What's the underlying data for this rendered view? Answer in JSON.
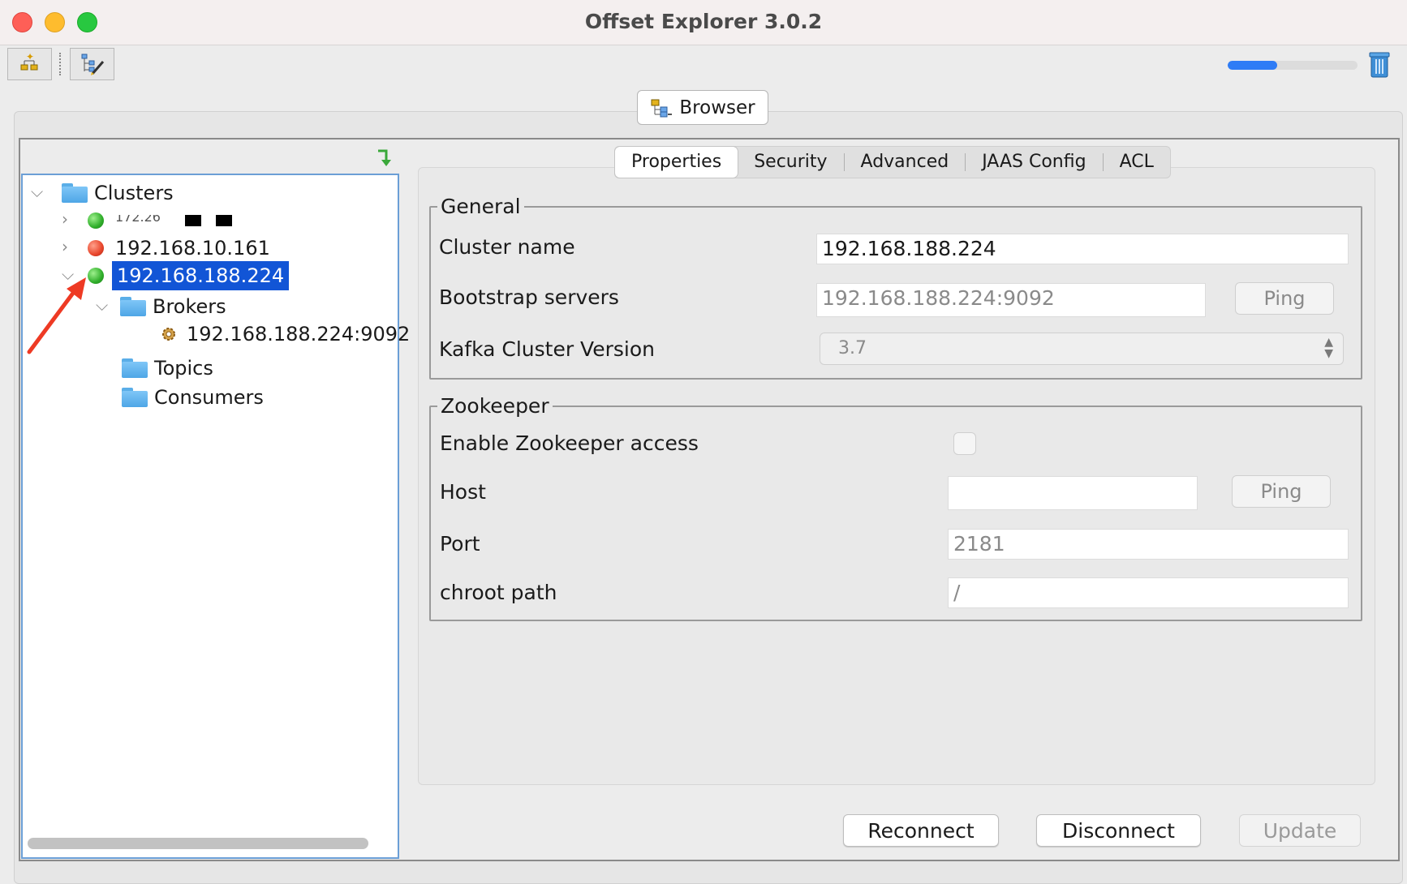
{
  "window": {
    "title": "Offset Explorer  3.0.2"
  },
  "toolbar": {
    "progress": 0.38
  },
  "browser_tab": {
    "label": "Browser"
  },
  "tree": {
    "root": "Clusters",
    "clusters": [
      {
        "label": "172.26",
        "status": "connected",
        "expanded": false
      },
      {
        "label": "192.168.10.161",
        "status": "error",
        "expanded": false
      },
      {
        "label": "192.168.188.224",
        "status": "connected",
        "expanded": true,
        "selected": true
      }
    ],
    "children": {
      "brokers": "Brokers",
      "broker_item": "192.168.188.224:9092",
      "topics": "Topics",
      "consumers": "Consumers"
    }
  },
  "tabs": [
    {
      "label": "Properties",
      "active": true
    },
    {
      "label": "Security"
    },
    {
      "label": "Advanced"
    },
    {
      "label": "JAAS Config"
    },
    {
      "label": "ACL"
    }
  ],
  "general": {
    "legend": "General",
    "cluster_name_label": "Cluster name",
    "cluster_name_value": "192.168.188.224",
    "bootstrap_label": "Bootstrap servers",
    "bootstrap_value": "192.168.188.224:9092",
    "ping_label": "Ping",
    "version_label": "Kafka Cluster Version",
    "version_value": "3.7"
  },
  "zookeeper": {
    "legend": "Zookeeper",
    "enable_label": "Enable Zookeeper access",
    "enabled": false,
    "host_label": "Host",
    "host_value": "",
    "ping_label": "Ping",
    "port_label": "Port",
    "port_value": "2181",
    "chroot_label": "chroot path",
    "chroot_value": "/"
  },
  "actions": {
    "reconnect": "Reconnect",
    "disconnect": "Disconnect",
    "update": "Update"
  },
  "colors": {
    "selection": "#1255d6",
    "connected": "#2fae2a",
    "error": "#e8452b",
    "annotation_arrow": "#ee3a24"
  }
}
